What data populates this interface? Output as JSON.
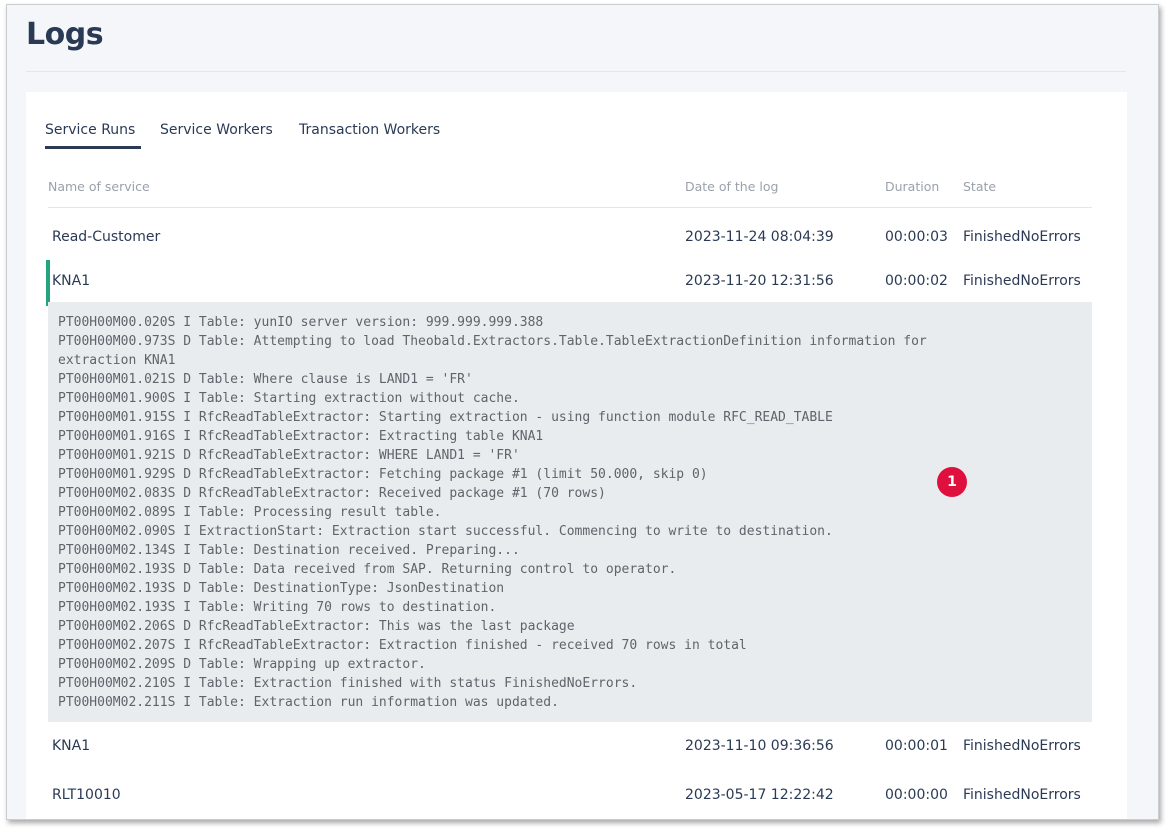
{
  "page": {
    "title": "Logs"
  },
  "tabs": [
    {
      "label": "Service Runs",
      "active": true
    },
    {
      "label": "Service Workers",
      "active": false
    },
    {
      "label": "Transaction Workers",
      "active": false
    }
  ],
  "table": {
    "columns": {
      "name": "Name of service",
      "date": "Date of the log",
      "duration": "Duration",
      "state": "State"
    },
    "rows": [
      {
        "name": "Read-Customer",
        "date": "2023-11-24 08:04:39",
        "duration": "00:00:03",
        "state": "FinishedNoErrors"
      },
      {
        "name": "KNA1",
        "date": "2023-11-20 12:31:56",
        "duration": "00:00:02",
        "state": "FinishedNoErrors",
        "selected": true
      },
      {
        "name": "KNA1",
        "date": "2023-11-10 09:36:56",
        "duration": "00:00:01",
        "state": "FinishedNoErrors"
      },
      {
        "name": "RLT10010",
        "date": "2023-05-17 12:22:42",
        "duration": "00:00:00",
        "state": "FinishedNoErrors"
      }
    ]
  },
  "log": {
    "lines": [
      "PT00H00M00.020S I Table: yunIO server version: 999.999.999.388",
      "PT00H00M00.973S D Table: Attempting to load Theobald.Extractors.Table.TableExtractionDefinition information for",
      "extraction KNA1",
      "PT00H00M01.021S D Table: Where clause is LAND1 = 'FR'",
      "PT00H00M01.900S I Table: Starting extraction without cache.",
      "PT00H00M01.915S I RfcReadTableExtractor: Starting extraction - using function module RFC_READ_TABLE",
      "PT00H00M01.916S I RfcReadTableExtractor: Extracting table KNA1",
      "PT00H00M01.921S D RfcReadTableExtractor: WHERE LAND1 = 'FR'",
      "PT00H00M01.929S D RfcReadTableExtractor: Fetching package #1 (limit 50.000, skip 0)",
      "PT00H00M02.083S D RfcReadTableExtractor: Received package #1 (70 rows)",
      "PT00H00M02.089S I Table: Processing result table.",
      "PT00H00M02.090S I ExtractionStart: Extraction start successful. Commencing to write to destination.",
      "PT00H00M02.134S I Table: Destination received. Preparing...",
      "PT00H00M02.193S D Table: Data received from SAP. Returning control to operator.",
      "PT00H00M02.193S D Table: DestinationType: JsonDestination",
      "PT00H00M02.193S I Table: Writing 70 rows to destination.",
      "PT00H00M02.206S D RfcReadTableExtractor: This was the last package",
      "PT00H00M02.207S I RfcReadTableExtractor: Extraction finished - received 70 rows in total",
      "PT00H00M02.209S D Table: Wrapping up extractor.",
      "PT00H00M02.210S I Table: Extraction finished with status FinishedNoErrors.",
      "PT00H00M02.211S I Table: Extraction run information was updated."
    ]
  },
  "annotation": {
    "marker_label": "1",
    "marker_color": "#e0103e"
  },
  "colors": {
    "accent": "#24a37f",
    "text": "#2a3a55",
    "muted": "#9aa1ab"
  }
}
